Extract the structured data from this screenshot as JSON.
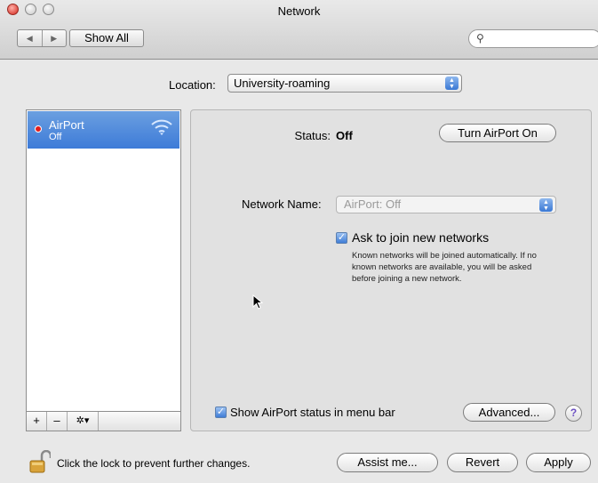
{
  "window": {
    "title": "Network"
  },
  "toolbar": {
    "back": "◀",
    "forward": "▶",
    "show_all": "Show All",
    "search_placeholder": ""
  },
  "location": {
    "label": "Location:",
    "value": "University-roaming"
  },
  "services": [
    {
      "name": "AirPort",
      "status": "Off",
      "status_color": "#e21d1d"
    }
  ],
  "sidebar_toolbar": {
    "add": "+",
    "remove": "–",
    "action": "✲▾"
  },
  "detail": {
    "status_label": "Status:",
    "status_value": "Off",
    "turn_on_button": "Turn AirPort On",
    "network_name_label": "Network Name:",
    "network_name_value": "AirPort: Off",
    "ask_checkbox": {
      "label": "Ask to join new networks",
      "checked": true
    },
    "ask_help": "Known networks will be joined automatically. If no known networks are available, you will be asked before joining a new network.",
    "menubar_checkbox": {
      "label": "Show AirPort status in menu bar",
      "checked": true
    },
    "advanced_button": "Advanced...",
    "help_button": "?"
  },
  "bottom": {
    "lock_text": "Click the lock to prevent further changes.",
    "assist_button": "Assist me...",
    "revert_button": "Revert",
    "apply_button": "Apply"
  },
  "colors": {
    "accent": "#3d7bd8",
    "close": "#d2241b"
  }
}
